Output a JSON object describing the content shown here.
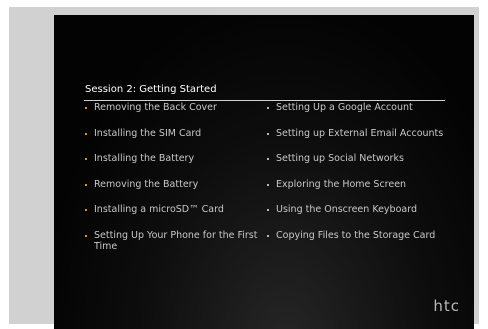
{
  "slide": {
    "session_title": "Session 2: Getting Started",
    "left_topics": [
      "Removing the Back Cover",
      "Installing the SIM Card",
      "Installing the Battery",
      "Removing the Battery",
      "Installing a microSD™ Card",
      "Setting Up Your Phone for the First Time"
    ],
    "right_topics": [
      "Setting Up a Google Account",
      "Setting up External Email Accounts",
      "Setting up Social Networks",
      "Exploring the Home Screen",
      "Using the Onscreen Keyboard",
      "Copying Files to the Storage Card"
    ],
    "brand": "htc"
  },
  "colors": {
    "background": "#030303",
    "frame": "#d1d1d1",
    "bullet_left": "#d49a1e",
    "bullet_right": "#b7b7b7",
    "text": "#c8c8c8",
    "title": "#ffffff"
  }
}
